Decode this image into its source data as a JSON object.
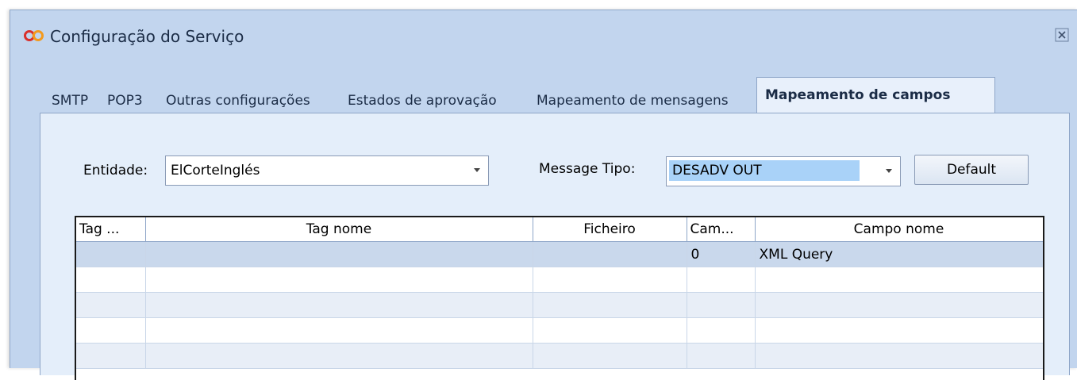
{
  "window": {
    "title": "Configuração do Serviço",
    "app_icon": "infinity-logo-icon",
    "close_icon": "close-icon"
  },
  "tabs": [
    {
      "label": "SMTP",
      "active": false
    },
    {
      "label": "POP3",
      "active": false
    },
    {
      "label": "Outras configurações",
      "active": false
    },
    {
      "label": "Estados de aprovação",
      "active": false
    },
    {
      "label": "Mapeamento de mensagens",
      "active": false
    },
    {
      "label": "Mapeamento de campos",
      "active": true
    }
  ],
  "form": {
    "entidade_label": "Entidade:",
    "entidade_value": "ElCorteInglés",
    "message_tipo_label": "Message Tipo:",
    "message_tipo_value": "DESADV OUT",
    "default_button": "Default"
  },
  "grid": {
    "columns": [
      "Tag ...",
      "Tag nome",
      "Ficheiro",
      "Cam...",
      "Campo nome"
    ],
    "rows": [
      [
        "",
        "",
        "",
        "0",
        "XML Query"
      ],
      [
        "",
        "",
        "",
        "",
        ""
      ],
      [
        "",
        "",
        "",
        "",
        ""
      ],
      [
        "",
        "",
        "",
        "",
        ""
      ],
      [
        "",
        "",
        "",
        "",
        ""
      ]
    ]
  },
  "colors": {
    "window_bg": "#c2d5ee",
    "panel_bg": "#e4eefa",
    "selection": "#a9d2f8",
    "logo_red": "#d9302c",
    "logo_orange": "#f39a1e"
  }
}
